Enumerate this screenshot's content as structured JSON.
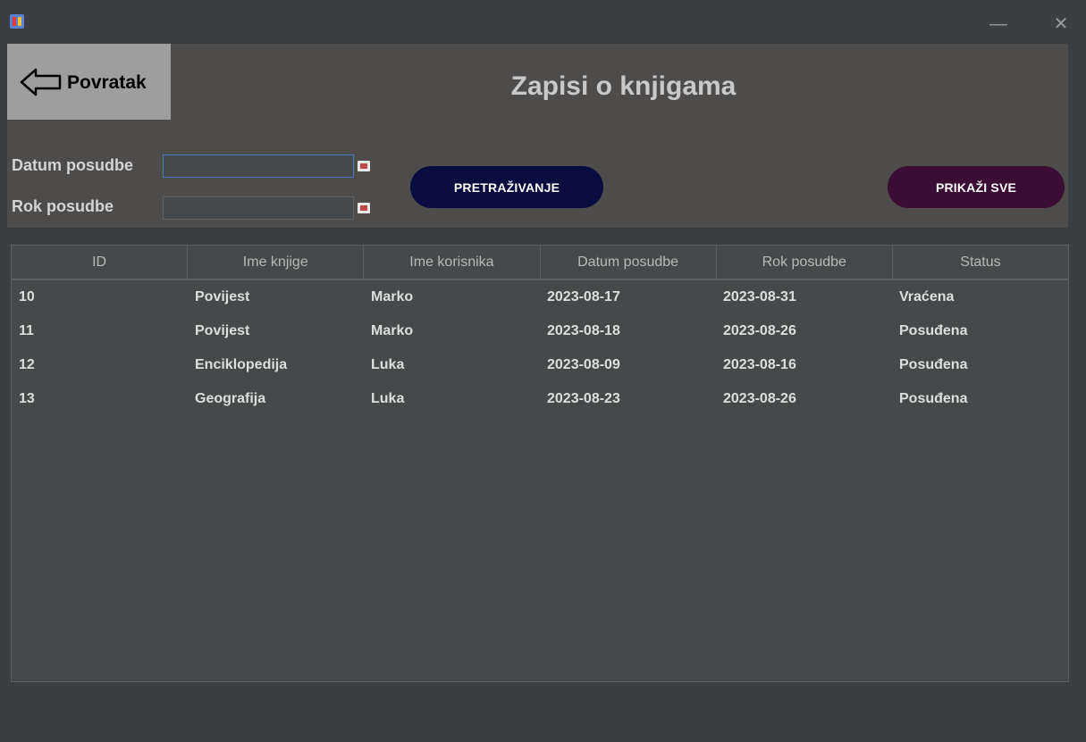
{
  "window": {
    "minimize_glyph": "—",
    "close_glyph": "✕"
  },
  "header": {
    "back_label": "Povratak",
    "title": "Zapisi o knjigama",
    "background": "#4e4b4b"
  },
  "filters": {
    "datum_label": "Datum posudbe",
    "datum_value": "",
    "rok_label": "Rok posudbe",
    "rok_value": "",
    "search_button": "PRETRAŽIVANJE",
    "show_all_button": "PRIKAŽI SVE",
    "search_color": "#090c3f",
    "show_all_color": "#3b0d35"
  },
  "table": {
    "columns": [
      "ID",
      "Ime knjige",
      "Ime korisnika",
      "Datum posudbe",
      "Rok posudbe",
      "Status"
    ],
    "rows": [
      [
        "10",
        "Povijest",
        "Marko",
        "2023-08-17",
        "2023-08-31",
        "Vraćena"
      ],
      [
        "11",
        "Povijest",
        "Marko",
        "2023-08-18",
        "2023-08-26",
        "Posuđena"
      ],
      [
        "12",
        "Enciklopedija",
        "Luka",
        "2023-08-09",
        "2023-08-16",
        "Posuđena"
      ],
      [
        "13",
        "Geografija",
        "Luka",
        "2023-08-23",
        "2023-08-26",
        "Posuđena"
      ]
    ]
  }
}
